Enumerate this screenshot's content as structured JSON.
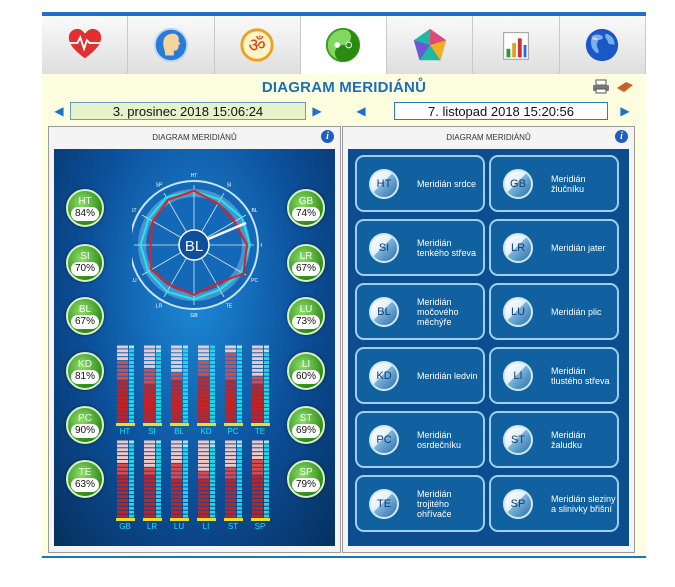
{
  "header": {
    "title": "DIAGRAM MERIDIÁNŮ",
    "tabs": [
      {
        "icon": "heart-ecg-icon"
      },
      {
        "icon": "head-profile-icon"
      },
      {
        "icon": "om-symbol-icon"
      },
      {
        "icon": "yin-yang-icon"
      },
      {
        "icon": "pentagon-chart-icon"
      },
      {
        "icon": "bar-chart-icon"
      },
      {
        "icon": "globe-icon"
      }
    ],
    "active_tab": 3
  },
  "dates": {
    "left": "3. prosinec 2018 15:06:24",
    "right": "7. listopad 2018 15:20:56"
  },
  "left_panel": {
    "title": "DIAGRAM MERIDIÁNŮ",
    "center_label": "BL",
    "badges_left": [
      {
        "name": "HT",
        "value": "84%"
      },
      {
        "name": "SI",
        "value": "70%"
      },
      {
        "name": "BL",
        "value": "67%"
      },
      {
        "name": "KD",
        "value": "81%"
      },
      {
        "name": "PC",
        "value": "90%"
      },
      {
        "name": "TE",
        "value": "63%"
      }
    ],
    "badges_right": [
      {
        "name": "GB",
        "value": "74%"
      },
      {
        "name": "LR",
        "value": "67%"
      },
      {
        "name": "LU",
        "value": "73%"
      },
      {
        "name": "LI",
        "value": "60%"
      },
      {
        "name": "ST",
        "value": "69%"
      },
      {
        "name": "SP",
        "value": "79%"
      }
    ],
    "radar_labels": [
      "HT",
      "SI",
      "BL",
      "KD",
      "PC",
      "TE",
      "GB",
      "LR",
      "LU",
      "LI",
      "ST",
      "SP"
    ],
    "bar_groups": [
      {
        "labels": [
          "HT",
          "SI",
          "BL",
          "KD",
          "PC",
          "TE"
        ],
        "levels": [
          0.84,
          0.7,
          0.67,
          0.81,
          0.9,
          0.63
        ],
        "ref_levels": [
          0.55,
          0.52,
          0.58,
          0.6,
          0.57,
          0.5
        ]
      },
      {
        "labels": [
          "GB",
          "LR",
          "LU",
          "LI",
          "ST",
          "SP"
        ],
        "levels": [
          0.74,
          0.67,
          0.73,
          0.6,
          0.69,
          0.79
        ],
        "ref_levels": [
          0.56,
          0.55,
          0.53,
          0.54,
          0.52,
          0.58
        ]
      }
    ],
    "colors": {
      "current": "#e02020",
      "reference": "#20e8e8",
      "badge": "#3a9a22"
    }
  },
  "right_panel": {
    "title": "DIAGRAM MERIDIÁNŮ",
    "buttons": [
      {
        "code": "HT",
        "label": "Meridián srdce"
      },
      {
        "code": "GB",
        "label": "Meridián žlučníku"
      },
      {
        "code": "SI",
        "label": "Meridián tenkého střeva"
      },
      {
        "code": "LR",
        "label": "Meridián jater"
      },
      {
        "code": "BL",
        "label": "Meridián močového měchýře"
      },
      {
        "code": "LU",
        "label": "Meridián plic"
      },
      {
        "code": "KD",
        "label": "Meridián ledvin"
      },
      {
        "code": "LI",
        "label": "Meridián tlustého střeva"
      },
      {
        "code": "PC",
        "label": "Meridián osrdečníku"
      },
      {
        "code": "ST",
        "label": "Meridián žaludku"
      },
      {
        "code": "TE",
        "label": "Meridián trojitého ohřívače"
      },
      {
        "code": "SP",
        "label": "Meridián sleziny a slinivky břišní"
      }
    ]
  }
}
